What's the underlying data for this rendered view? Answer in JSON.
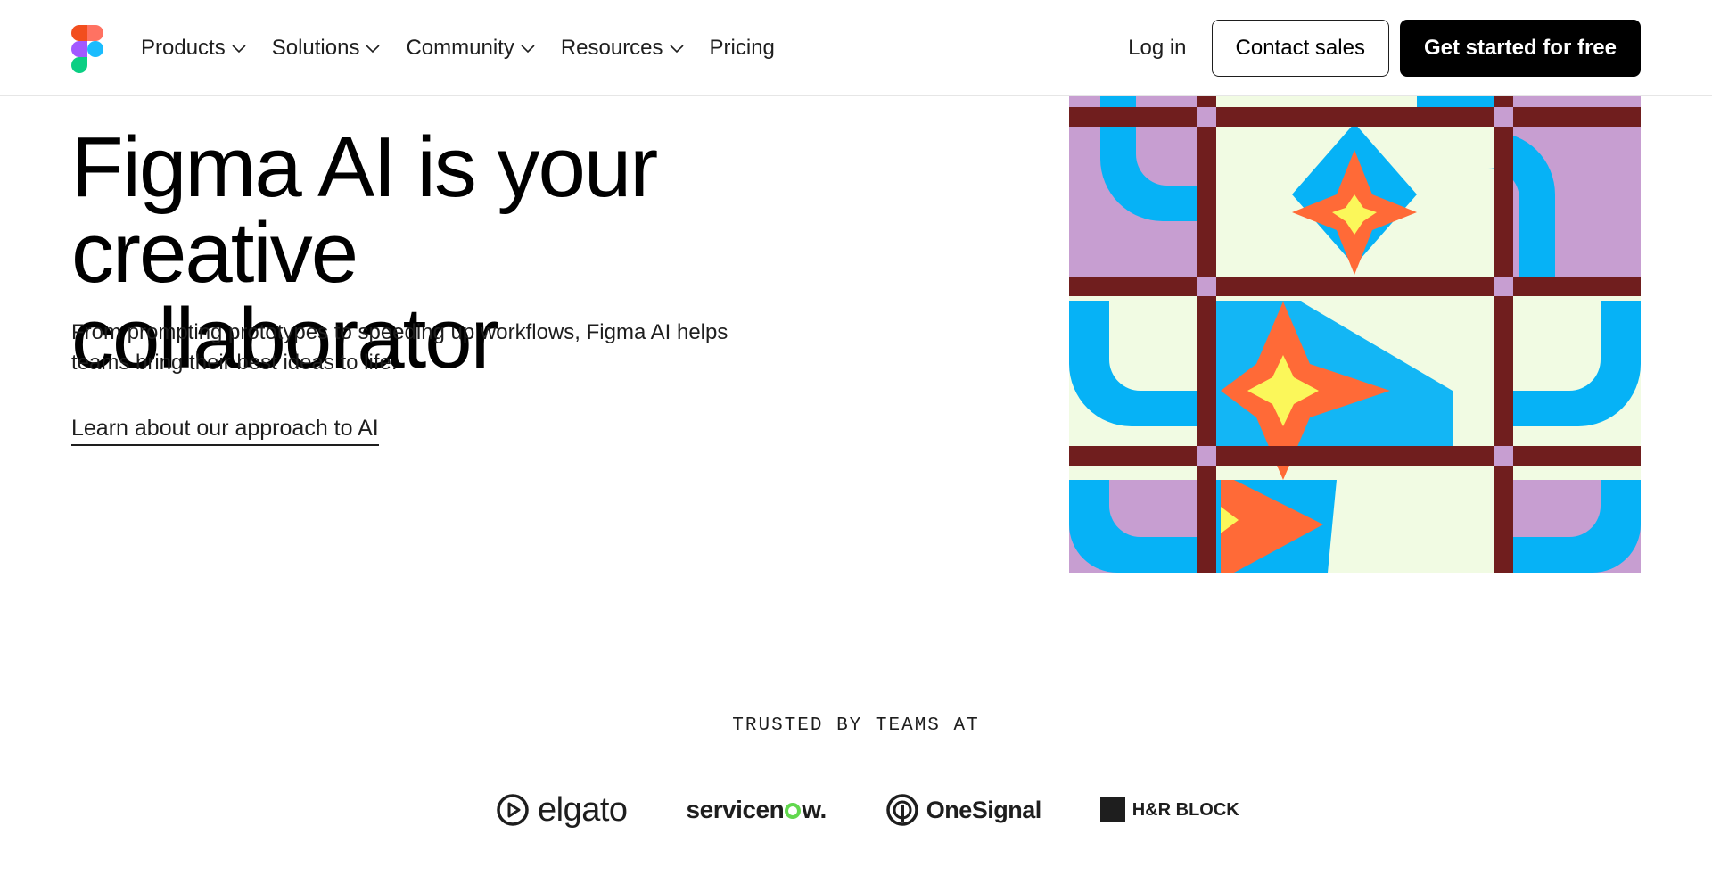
{
  "header": {
    "nav": [
      {
        "label": "Products",
        "has_dropdown": true
      },
      {
        "label": "Solutions",
        "has_dropdown": true
      },
      {
        "label": "Community",
        "has_dropdown": true
      },
      {
        "label": "Resources",
        "has_dropdown": true
      },
      {
        "label": "Pricing",
        "has_dropdown": false
      }
    ],
    "login_label": "Log in",
    "contact_label": "Contact sales",
    "cta_label": "Get started for free"
  },
  "hero": {
    "title_line1": "Figma AI is your creative",
    "title_line2": "collaborator",
    "subtitle_line1": "From prompting prototypes to speeding up workflows, Figma AI helps",
    "subtitle_line2": "teams bring their best ideas to life.",
    "link_label": "Learn about our approach to AI"
  },
  "trusted": {
    "heading": "TRUSTED BY TEAMS AT",
    "logos": [
      {
        "name": "elgato",
        "text": "elgato"
      },
      {
        "name": "servicenow",
        "text_a": "servicen",
        "text_b": "w",
        "text_c": "."
      },
      {
        "name": "onesignal",
        "text": "OneSignal"
      },
      {
        "name": "hrblock",
        "text": "H&R BLOCK"
      }
    ]
  },
  "colors": {
    "art_cream": "#f1fbe3",
    "art_lilac": "#c79ed1",
    "art_blue": "#06b2f6",
    "art_orange": "#ff6a37",
    "art_yellow": "#fbf75a",
    "art_maroon": "#701e1e",
    "servicenow_green": "#62d84e"
  }
}
